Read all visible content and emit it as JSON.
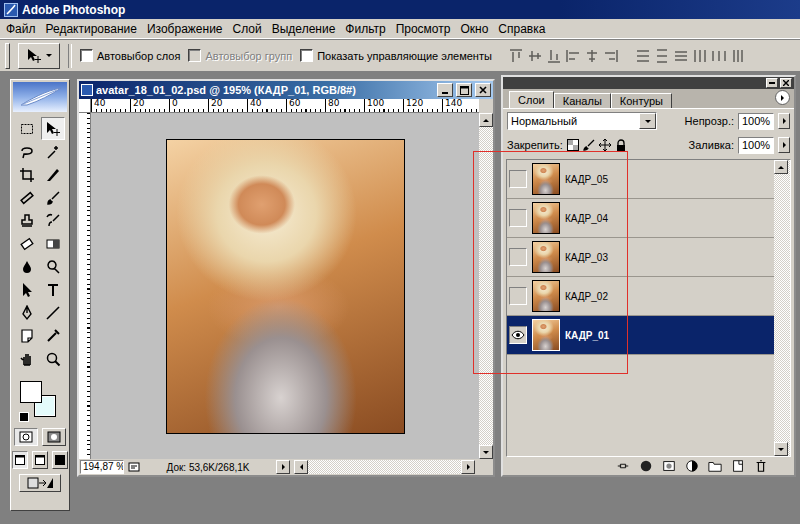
{
  "window": {
    "title": "Adobe Photoshop"
  },
  "menu": [
    "Файл",
    "Редактирование",
    "Изображение",
    "Слой",
    "Выделение",
    "Фильтр",
    "Просмотр",
    "Окно",
    "Справка"
  ],
  "options_bar": {
    "checkboxes": [
      {
        "label": "Автовыбор слоя",
        "checked": false,
        "disabled": false
      },
      {
        "label": "Автовыбор групп",
        "checked": false,
        "disabled": true
      },
      {
        "label": "Показать управляющие элементы",
        "checked": false,
        "disabled": false
      }
    ]
  },
  "toolbox": {
    "tools": [
      {
        "selected": false
      },
      {
        "selected": true
      },
      {
        "selected": false
      },
      {
        "selected": false
      },
      {
        "selected": false
      },
      {
        "selected": false
      },
      {
        "selected": false
      },
      {
        "selected": false
      },
      {
        "selected": false
      },
      {
        "selected": false
      },
      {
        "selected": false
      },
      {
        "selected": false
      },
      {
        "selected": false
      },
      {
        "selected": false
      },
      {
        "selected": false
      },
      {
        "selected": false
      },
      {
        "selected": false
      },
      {
        "selected": false
      },
      {
        "selected": false
      },
      {
        "selected": false
      },
      {
        "selected": false
      },
      {
        "selected": false
      }
    ],
    "foreground_color": "#ffffff",
    "background_color": "#e4fbfb"
  },
  "document": {
    "title": "avatar_18_01_02.psd @ 195% (КАДР_01, RGB/8#)",
    "ruler": [
      "40",
      "20",
      "0",
      "20",
      "40",
      "60",
      "80",
      "100",
      "120",
      "140"
    ],
    "zoom": "194,87 %",
    "doc_info": "Док: 53,6K/268,1K"
  },
  "layers_palette": {
    "tabs": [
      {
        "label": "Слои",
        "selected": true
      },
      {
        "label": "Каналы",
        "selected": false
      },
      {
        "label": "Контуры",
        "selected": false
      }
    ],
    "blend_mode": "Нормальный",
    "opacity_label": "Непрозр.:",
    "opacity": "100%",
    "lock_label": "Закрепить:",
    "fill_label": "Заливка:",
    "fill": "100%",
    "layers": [
      {
        "name": "КАДР_05",
        "visible": false,
        "selected": false
      },
      {
        "name": "КАДР_04",
        "visible": false,
        "selected": false
      },
      {
        "name": "КАДР_03",
        "visible": false,
        "selected": false
      },
      {
        "name": "КАДР_02",
        "visible": false,
        "selected": false
      },
      {
        "name": "КАДР_01",
        "visible": true,
        "selected": true
      }
    ]
  }
}
